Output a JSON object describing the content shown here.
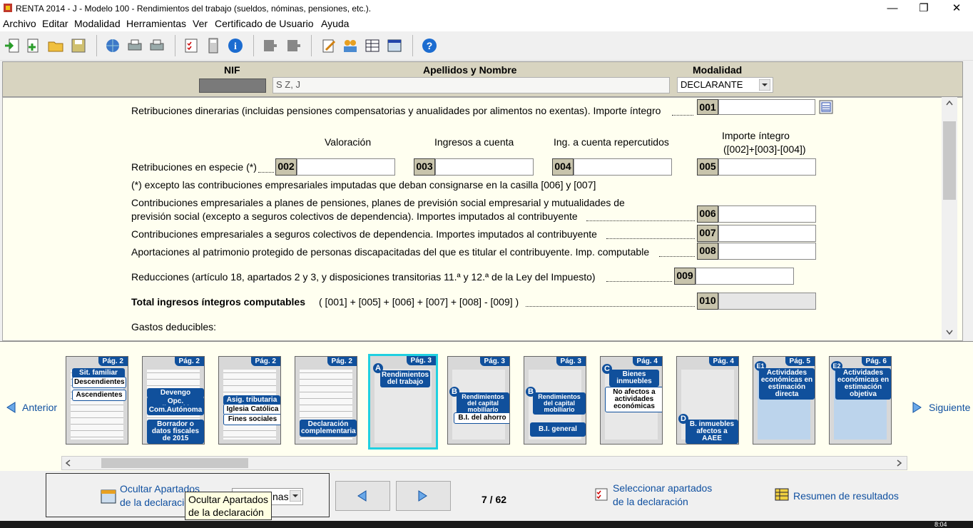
{
  "window": {
    "title": "RENTA 2014 - J - Modelo 100 - Rendimientos del trabajo (sueldos, nóminas, pensiones, etc.).",
    "minimize": "—",
    "restore": "❐",
    "close": "✕"
  },
  "menu": [
    "Archivo",
    "Editar",
    "Modalidad",
    "Herramientas",
    "Ver",
    "Certificado de Usuario",
    "Ayuda"
  ],
  "header": {
    "nif_label": "NIF",
    "nif_value": "",
    "name_label": "Apellidos y Nombre",
    "name_value": "S Z, J",
    "modalidad_label": "Modalidad",
    "modalidad_value": "DECLARANTE"
  },
  "form": {
    "r001_label": "Retribuciones dinerarias (incluidas pensiones compensatorias y anualidades por alimentos no exentas). Importe íntegro",
    "col_valoracion": "Valoración",
    "col_ingresos": "Ingresos a cuenta",
    "col_repercutidos": "Ing. a cuenta repercutidos",
    "col_importe_1": "Importe íntegro",
    "col_importe_2": "([002]+[003]-[004])",
    "especie_label": "Retribuciones en especie (*)",
    "especie_note": "(*) excepto las contribuciones empresariales imputadas que deban consignarse en la casilla [006] y [007]",
    "r006_label_1": "Contribuciones empresariales a planes de pensiones, planes de previsión social empresarial y mutualidades de",
    "r006_label_2": "previsión social (excepto a seguros colectivos de dependencia). Importes imputados al contribuyente",
    "r007_label": "Contribuciones empresariales a seguros colectivos de dependencia. Importes imputados al contribuyente",
    "r008_label": "Aportaciones al patrimonio protegido de personas discapacitadas del que es titular el contribuyente. Imp. computable",
    "r009_label": "Reducciones (artículo 18, apartados 2 y 3, y disposiciones transitorias 11.ª y 12.ª de la Ley del Impuesto)",
    "r010_label_bold": "Total ingresos íntegros computables",
    "r010_label_formula": "( [001] + [005] + [006] + [007] + [008] - [009] )",
    "gastos_label": "Gastos deducibles:",
    "codes": [
      "001",
      "002",
      "003",
      "004",
      "005",
      "006",
      "007",
      "008",
      "009",
      "010"
    ]
  },
  "thumbnails": [
    {
      "page": "Pág. 2",
      "labels": [
        "Sit. familiar",
        "Descendientes",
        "Ascendientes"
      ]
    },
    {
      "page": "Pág. 2",
      "labels": [
        "Devengo",
        "Opc. tributación",
        "Com.Autónoma",
        "Borrador o datos fiscales de 2015"
      ]
    },
    {
      "page": "Pág. 2",
      "labels": [
        "Asig. tributaria",
        "Iglesia Católica",
        "Fines sociales"
      ]
    },
    {
      "page": "Pág. 2",
      "labels": [
        "Declaración complementaria"
      ]
    },
    {
      "page": "Pág. 3",
      "letter": "A",
      "labels": [
        "Rendimientos del trabajo"
      ]
    },
    {
      "page": "Pág. 3",
      "letter": "B",
      "labels": [
        "Rendimientos del capital mobiliario",
        "B.I. del ahorro"
      ]
    },
    {
      "page": "Pág. 3",
      "letter": "B",
      "labels": [
        "Rendimientos del capital mobiliario",
        "B.I. general"
      ]
    },
    {
      "page": "Pág. 4",
      "letter": "C",
      "labels": [
        "Bienes inmuebles",
        "No afectos a actividades económicas"
      ]
    },
    {
      "page": "Pág. 4",
      "letter": "D",
      "labels": [
        "B. inmuebles afectos a AAEE"
      ]
    },
    {
      "page": "Pág. 5",
      "letter": "E1",
      "labels": [
        "Actividades económicas en estimación directa"
      ]
    },
    {
      "page": "Pág. 6",
      "letter": "E2",
      "labels": [
        "Actividades económicas en estimación objetiva"
      ]
    }
  ],
  "nav": {
    "prev": "Anterior",
    "next": "Siguiente",
    "counter": "7 / 62",
    "hide_sections_1": "Ocultar Apartados",
    "hide_sections_2": "de la declaración",
    "select_partial": "nas",
    "select_sections_1": "Seleccionar apartados",
    "select_sections_2": "de la declaración",
    "summary": "Resumen de resultados",
    "tooltip_1": "Ocultar Apartados",
    "tooltip_2": "de la declaración",
    "clock": "8:04"
  },
  "colors": {
    "accent": "#10509c",
    "form_bg": "#fffff0",
    "code_bg": "#c8c4ac",
    "selected_border": "#20d0e0"
  }
}
